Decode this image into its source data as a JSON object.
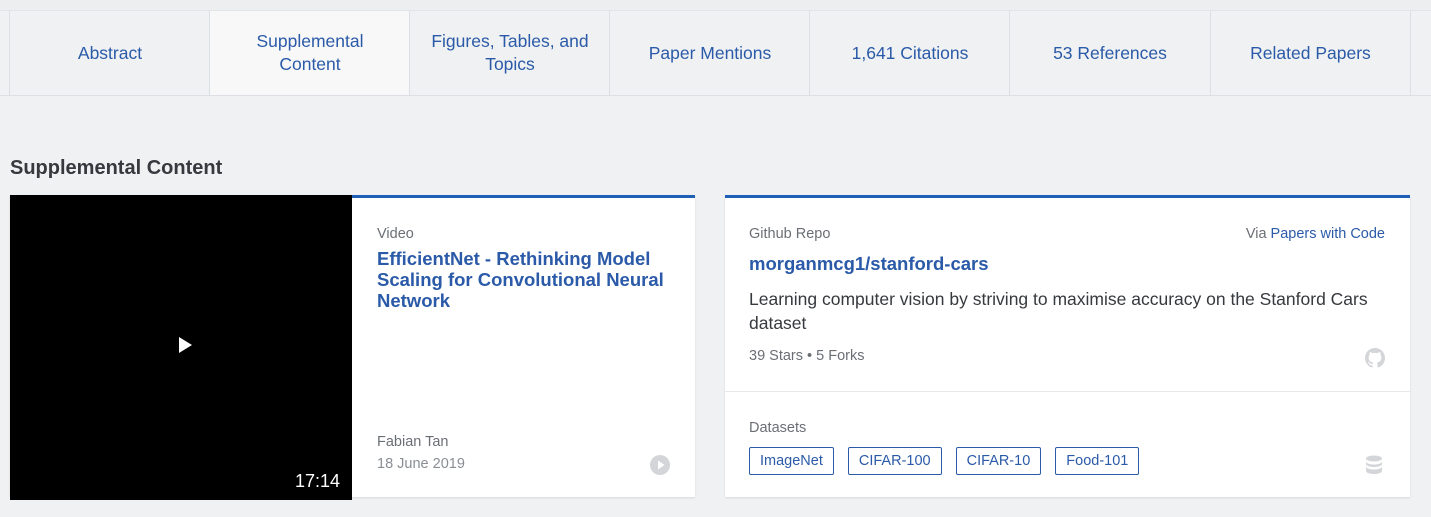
{
  "tabs": [
    {
      "label": "Abstract",
      "active": false
    },
    {
      "label": "Supplemental Content",
      "active": true
    },
    {
      "label": "Figures, Tables, and Topics",
      "active": false
    },
    {
      "label": "Paper Mentions",
      "active": false
    },
    {
      "label": "1,641 Citations",
      "active": false
    },
    {
      "label": "53 References",
      "active": false
    },
    {
      "label": "Related Papers",
      "active": false
    }
  ],
  "section_title": "Supplemental Content",
  "video_card": {
    "type_label": "Video",
    "title": "EfficientNet - Rethinking Model Scaling for Convolutional Neural Network",
    "duration": "17:14",
    "author": "Fabian Tan",
    "date": "18 June 2019"
  },
  "repo_card": {
    "type_label": "Github Repo",
    "via_prefix": "Via",
    "via_link": "Papers with Code",
    "name": "morganmcg1/stanford-cars",
    "description": "Learning computer vision by striving to maximise accuracy on the Stanford Cars dataset",
    "stats": "39 Stars • 5 Forks",
    "datasets_label": "Datasets",
    "datasets": [
      "ImageNet",
      "CIFAR-100",
      "CIFAR-10",
      "Food-101"
    ]
  },
  "colors": {
    "accent": "#1f5fb5",
    "link": "#2a5aa8",
    "background": "#f0f1f3"
  },
  "icons": {
    "play": "play-icon",
    "circle_play": "circle-play-icon",
    "github": "github-icon",
    "database": "database-icon"
  }
}
